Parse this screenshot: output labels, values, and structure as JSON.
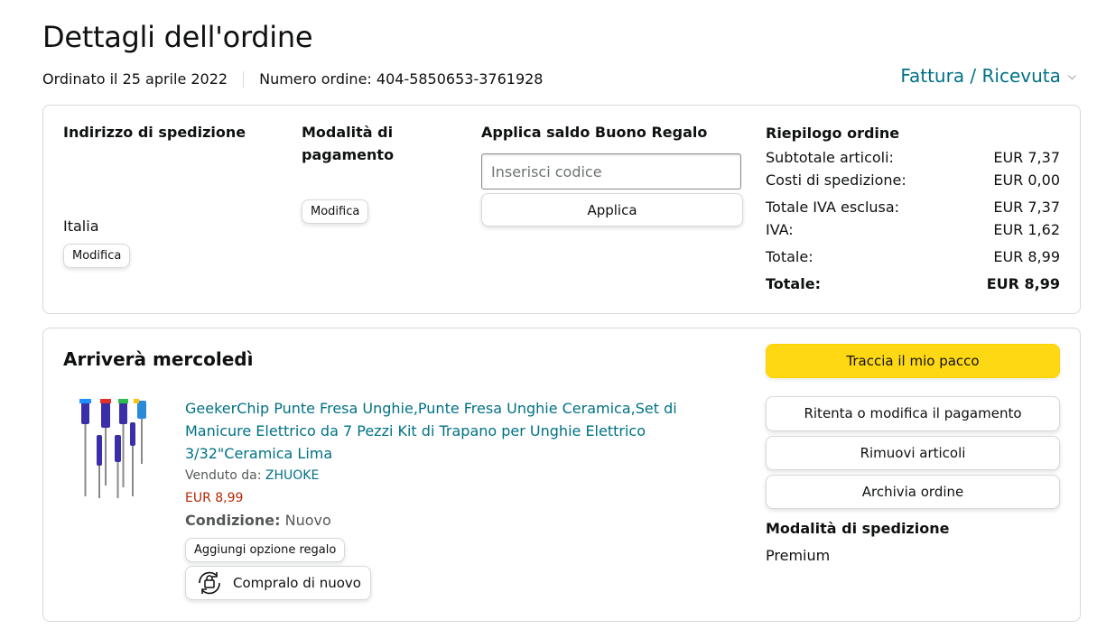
{
  "header": {
    "title": "Dettagli dell'ordine",
    "ordered_on": "Ordinato il 25 aprile 2022",
    "order_number": "Numero ordine: 404-5850653-3761928",
    "invoice_link": "Fattura / Ricevuta"
  },
  "shipping_address": {
    "title": "Indirizzo di spedizione",
    "country": "Italia",
    "edit_label": "Modifica"
  },
  "payment": {
    "title_line1": "Modalità di",
    "title_line2": "pagamento",
    "edit_label": "Modifica"
  },
  "gift_card": {
    "title": "Applica saldo Buono Regalo",
    "placeholder": "Inserisci codice",
    "apply_label": "Applica"
  },
  "summary": {
    "title": "Riepilogo ordine",
    "rows": [
      {
        "label": "Subtotale articoli:",
        "value": "EUR 7,37"
      },
      {
        "label": "Costi di spedizione:",
        "value": "EUR 0,00"
      },
      {
        "label": "Totale IVA esclusa:",
        "value": "EUR 7,37"
      },
      {
        "label": "IVA:",
        "value": "EUR 1,62"
      },
      {
        "label": "Totale:",
        "value": "EUR 8,99"
      },
      {
        "label": "Totale:",
        "value": "EUR 8,99"
      }
    ]
  },
  "shipment": {
    "arrival": "Arriverà mercoledì",
    "product_title": "GeekerChip Punte Fresa Unghie,Punte Fresa Unghie Ceramica,Set di Manicure Elettrico da 7 Pezzi Kit di Trapano per Unghie Elettrico 3/32\"Ceramica Lima",
    "sold_by_label": "Venduto da:",
    "seller": "ZHUOKE",
    "price": "EUR 8,99",
    "condition_label": "Condizione:",
    "condition_value": "Nuovo",
    "gift_option_label": "Aggiungi opzione regalo",
    "buy_again_label": "Compralo di nuovo"
  },
  "actions": {
    "track": "Traccia il mio pacco",
    "retry_payment": "Ritenta o modifica il pagamento",
    "remove_items": "Rimuovi articoli",
    "archive": "Archivia ordine",
    "shipping_method_title": "Modalità di spedizione",
    "shipping_method_value": "Premium"
  },
  "colors": {
    "link": "#007185",
    "price": "#B12704",
    "primary_button": "#FFD814",
    "border": "#D5D9D9"
  },
  "icons": [
    "chevron-down-icon",
    "buy-again-icon"
  ]
}
